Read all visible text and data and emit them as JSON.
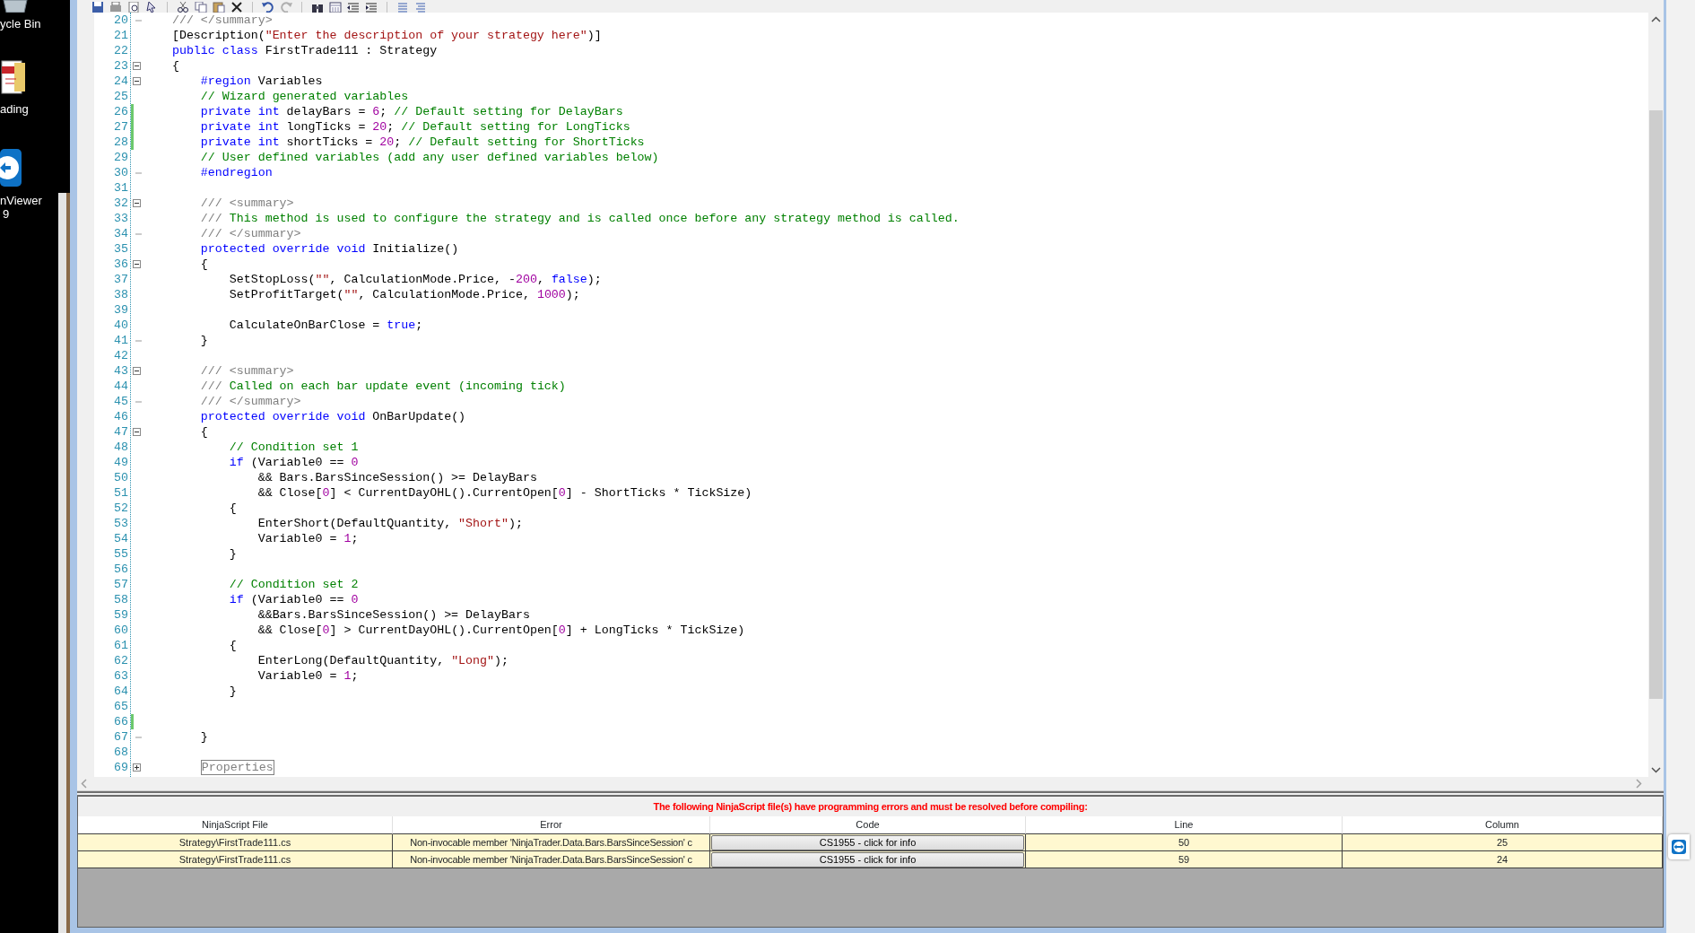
{
  "desktop": {
    "icons": [
      {
        "kind": "bin",
        "label": "ycle Bin"
      },
      {
        "kind": "document",
        "label": "ading"
      },
      {
        "kind": "remote",
        "label": "nViewer",
        "sublabel": "9"
      }
    ]
  },
  "editor": {
    "lines": [
      {
        "number": "20",
        "fold": {
          "kind": "end"
        },
        "changed": false,
        "tokens": [
          {
            "kind": "doc",
            "text": "    /// </summary>"
          }
        ]
      },
      {
        "number": "21",
        "changed": false,
        "tokens": [
          {
            "kind": "plain",
            "text": "    [Description("
          },
          {
            "kind": "string",
            "text": "\"Enter the description of your strategy here\""
          },
          {
            "kind": "plain",
            "text": ")]"
          }
        ]
      },
      {
        "number": "22",
        "changed": false,
        "tokens": [
          {
            "kind": "keyword",
            "text": "    public class"
          },
          {
            "kind": "plain",
            "text": " FirstTrade111 : Strategy"
          }
        ]
      },
      {
        "number": "23",
        "fold": {
          "kind": "open"
        },
        "changed": false,
        "tokens": [
          {
            "kind": "plain",
            "text": "    {"
          }
        ]
      },
      {
        "number": "24",
        "fold": {
          "kind": "open"
        },
        "changed": false,
        "tokens": [
          {
            "kind": "preproc",
            "text": "        #region"
          },
          {
            "kind": "plain",
            "text": " Variables"
          }
        ]
      },
      {
        "number": "25",
        "changed": false,
        "tokens": [
          {
            "kind": "comment",
            "text": "        // Wizard generated variables"
          }
        ]
      },
      {
        "number": "26",
        "changed": true,
        "tokens": [
          {
            "kind": "keyword",
            "text": "        private int"
          },
          {
            "kind": "plain",
            "text": " delayBars = "
          },
          {
            "kind": "number",
            "text": "6"
          },
          {
            "kind": "plain",
            "text": "; "
          },
          {
            "kind": "comment",
            "text": "// Default setting for DelayBars"
          }
        ]
      },
      {
        "number": "27",
        "changed": true,
        "tokens": [
          {
            "kind": "keyword",
            "text": "        private int"
          },
          {
            "kind": "plain",
            "text": " longTicks = "
          },
          {
            "kind": "number",
            "text": "20"
          },
          {
            "kind": "plain",
            "text": "; "
          },
          {
            "kind": "comment",
            "text": "// Default setting for LongTicks"
          }
        ]
      },
      {
        "number": "28",
        "changed": true,
        "tokens": [
          {
            "kind": "keyword",
            "text": "        private int"
          },
          {
            "kind": "plain",
            "text": " shortTicks = "
          },
          {
            "kind": "number",
            "text": "20"
          },
          {
            "kind": "plain",
            "text": "; "
          },
          {
            "kind": "comment",
            "text": "// Default setting for ShortTicks"
          }
        ]
      },
      {
        "number": "29",
        "changed": false,
        "tokens": [
          {
            "kind": "comment",
            "text": "        // User defined variables (add any user defined variables below)"
          }
        ]
      },
      {
        "number": "30",
        "fold": {
          "kind": "end"
        },
        "changed": false,
        "tokens": [
          {
            "kind": "preproc",
            "text": "        #endregion"
          }
        ]
      },
      {
        "number": "31",
        "changed": false
      },
      {
        "number": "32",
        "fold": {
          "kind": "open"
        },
        "changed": false,
        "tokens": [
          {
            "kind": "doc",
            "text": "        /// <summary>"
          }
        ]
      },
      {
        "number": "33",
        "changed": false,
        "tokens": [
          {
            "kind": "doc",
            "text": "        ///"
          },
          {
            "kind": "comment",
            "text": " This method is used to configure the strategy and is called once before any strategy method is called."
          }
        ]
      },
      {
        "number": "34",
        "fold": {
          "kind": "end"
        },
        "changed": false,
        "tokens": [
          {
            "kind": "doc",
            "text": "        /// </summary>"
          }
        ]
      },
      {
        "number": "35",
        "changed": false,
        "tokens": [
          {
            "kind": "keyword",
            "text": "        protected override void"
          },
          {
            "kind": "plain",
            "text": " Initialize()"
          }
        ]
      },
      {
        "number": "36",
        "fold": {
          "kind": "open"
        },
        "changed": false,
        "tokens": [
          {
            "kind": "plain",
            "text": "        {"
          }
        ]
      },
      {
        "number": "37",
        "changed": false,
        "tokens": [
          {
            "kind": "plain",
            "text": "            SetStopLoss("
          },
          {
            "kind": "string",
            "text": "\"\""
          },
          {
            "kind": "plain",
            "text": ", CalculationMode.Price, -"
          },
          {
            "kind": "number",
            "text": "200"
          },
          {
            "kind": "plain",
            "text": ", "
          },
          {
            "kind": "keyword",
            "text": "false"
          },
          {
            "kind": "plain",
            "text": ");"
          }
        ]
      },
      {
        "number": "38",
        "changed": false,
        "tokens": [
          {
            "kind": "plain",
            "text": "            SetProfitTarget("
          },
          {
            "kind": "string",
            "text": "\"\""
          },
          {
            "kind": "plain",
            "text": ", CalculationMode.Price, "
          },
          {
            "kind": "number",
            "text": "1000"
          },
          {
            "kind": "plain",
            "text": ");"
          }
        ]
      },
      {
        "number": "39",
        "changed": false
      },
      {
        "number": "40",
        "changed": false,
        "tokens": [
          {
            "kind": "plain",
            "text": "            CalculateOnBarClose = "
          },
          {
            "kind": "keyword",
            "text": "true"
          },
          {
            "kind": "plain",
            "text": ";"
          }
        ]
      },
      {
        "number": "41",
        "fold": {
          "kind": "end"
        },
        "changed": false,
        "tokens": [
          {
            "kind": "plain",
            "text": "        }"
          }
        ]
      },
      {
        "number": "42",
        "changed": false
      },
      {
        "number": "43",
        "fold": {
          "kind": "open"
        },
        "changed": false,
        "tokens": [
          {
            "kind": "doc",
            "text": "        /// <summary>"
          }
        ]
      },
      {
        "number": "44",
        "changed": false,
        "tokens": [
          {
            "kind": "doc",
            "text": "        ///"
          },
          {
            "kind": "comment",
            "text": " Called on each bar update event (incoming tick)"
          }
        ]
      },
      {
        "number": "45",
        "fold": {
          "kind": "end"
        },
        "changed": false,
        "tokens": [
          {
            "kind": "doc",
            "text": "        /// </summary>"
          }
        ]
      },
      {
        "number": "46",
        "changed": false,
        "tokens": [
          {
            "kind": "keyword",
            "text": "        protected override void"
          },
          {
            "kind": "plain",
            "text": " OnBarUpdate()"
          }
        ]
      },
      {
        "number": "47",
        "fold": {
          "kind": "open"
        },
        "changed": false,
        "tokens": [
          {
            "kind": "plain",
            "text": "        {"
          }
        ]
      },
      {
        "number": "48",
        "changed": false,
        "tokens": [
          {
            "kind": "comment",
            "text": "            // Condition set 1"
          }
        ]
      },
      {
        "number": "49",
        "changed": false,
        "tokens": [
          {
            "kind": "keyword",
            "text": "            if"
          },
          {
            "kind": "plain",
            "text": " (Variable0 == "
          },
          {
            "kind": "number",
            "text": "0"
          }
        ]
      },
      {
        "number": "50",
        "changed": false,
        "tokens": [
          {
            "kind": "plain",
            "text": "                && Bars.BarsSinceSession() >= DelayBars"
          }
        ]
      },
      {
        "number": "51",
        "changed": false,
        "tokens": [
          {
            "kind": "plain",
            "text": "                && Close["
          },
          {
            "kind": "number",
            "text": "0"
          },
          {
            "kind": "plain",
            "text": "] < CurrentDayOHL().CurrentOpen["
          },
          {
            "kind": "number",
            "text": "0"
          },
          {
            "kind": "plain",
            "text": "] - ShortTicks * TickSize)"
          }
        ]
      },
      {
        "number": "52",
        "changed": false,
        "tokens": [
          {
            "kind": "plain",
            "text": "            {"
          }
        ]
      },
      {
        "number": "53",
        "changed": false,
        "tokens": [
          {
            "kind": "plain",
            "text": "                EnterShort(DefaultQuantity, "
          },
          {
            "kind": "string",
            "text": "\"Short\""
          },
          {
            "kind": "plain",
            "text": ");"
          }
        ]
      },
      {
        "number": "54",
        "changed": false,
        "tokens": [
          {
            "kind": "plain",
            "text": "                Variable0 = "
          },
          {
            "kind": "number",
            "text": "1"
          },
          {
            "kind": "plain",
            "text": ";"
          }
        ]
      },
      {
        "number": "55",
        "changed": false,
        "tokens": [
          {
            "kind": "plain",
            "text": "            }"
          }
        ]
      },
      {
        "number": "56",
        "changed": false
      },
      {
        "number": "57",
        "changed": false,
        "tokens": [
          {
            "kind": "comment",
            "text": "            // Condition set 2"
          }
        ]
      },
      {
        "number": "58",
        "changed": false,
        "tokens": [
          {
            "kind": "keyword",
            "text": "            if"
          },
          {
            "kind": "plain",
            "text": " (Variable0 == "
          },
          {
            "kind": "number",
            "text": "0"
          }
        ]
      },
      {
        "number": "59",
        "changed": false,
        "tokens": [
          {
            "kind": "plain",
            "text": "                &&Bars.BarsSinceSession() >= DelayBars"
          }
        ]
      },
      {
        "number": "60",
        "changed": false,
        "tokens": [
          {
            "kind": "plain",
            "text": "                && Close["
          },
          {
            "kind": "number",
            "text": "0"
          },
          {
            "kind": "plain",
            "text": "] > CurrentDayOHL().CurrentOpen["
          },
          {
            "kind": "number",
            "text": "0"
          },
          {
            "kind": "plain",
            "text": "] + LongTicks * TickSize)"
          }
        ]
      },
      {
        "number": "61",
        "changed": false,
        "tokens": [
          {
            "kind": "plain",
            "text": "            {"
          }
        ]
      },
      {
        "number": "62",
        "changed": false,
        "tokens": [
          {
            "kind": "plain",
            "text": "                EnterLong(DefaultQuantity, "
          },
          {
            "kind": "string",
            "text": "\"Long\""
          },
          {
            "kind": "plain",
            "text": ");"
          }
        ]
      },
      {
        "number": "63",
        "changed": false,
        "tokens": [
          {
            "kind": "plain",
            "text": "                Variable0 = "
          },
          {
            "kind": "number",
            "text": "1"
          },
          {
            "kind": "plain",
            "text": ";"
          }
        ]
      },
      {
        "number": "64",
        "changed": false,
        "tokens": [
          {
            "kind": "plain",
            "text": "            }"
          }
        ]
      },
      {
        "number": "65",
        "changed": false
      },
      {
        "number": "66",
        "changed": true
      },
      {
        "number": "67",
        "fold": {
          "kind": "end"
        },
        "changed": false,
        "tokens": [
          {
            "kind": "plain",
            "text": "        }"
          }
        ]
      },
      {
        "number": "68",
        "changed": false
      },
      {
        "number": "69",
        "fold": {
          "kind": "collapsed"
        },
        "changed": false,
        "tokens": [
          {
            "kind": "collapsed",
            "text": "        Properties"
          }
        ]
      }
    ]
  },
  "error_panel": {
    "message": "The following NinjaScript file(s) have programming errors and must be resolved before compiling:",
    "columns": [
      "NinjaScript File",
      "Error",
      "Code",
      "Line",
      "Column"
    ],
    "rows": [
      {
        "file": "Strategy\\FirstTrade111.cs",
        "error": "Non-invocable member 'NinjaTrader.Data.Bars.BarsSinceSession' c",
        "code": "CS1955 - click for info",
        "line": "50",
        "column": "25"
      },
      {
        "file": "Strategy\\FirstTrade111.cs",
        "error": "Non-invocable member 'NinjaTrader.Data.Bars.BarsSinceSession' c",
        "code": "CS1955 - click for info",
        "line": "59",
        "column": "24"
      }
    ]
  }
}
